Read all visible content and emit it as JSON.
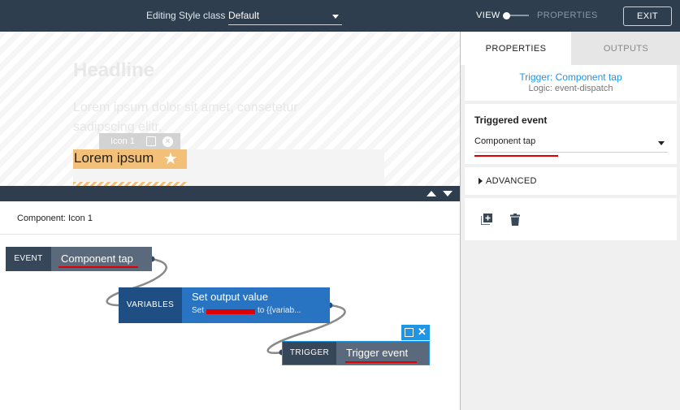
{
  "topbar": {
    "style_label": "Editing Style class",
    "style_value": "Default",
    "view_label": "VIEW",
    "properties_label": "PROPERTIES",
    "exit_label": "EXIT"
  },
  "preview": {
    "headline": "Headline",
    "lorem": "Lorem ipsum dolor sit amet, consetetur sadipscing elitr,",
    "icon_tag": "Icon 1",
    "highlight_text": "Lorem ipsum"
  },
  "editor": {
    "title": "Component: Icon 1",
    "event_node": {
      "tag": "EVENT",
      "label": "Component tap"
    },
    "variables_node": {
      "tag": "VARIABLES",
      "title": "Set output value",
      "subtitle_start": "Set",
      "subtitle_end": "to {{variab..."
    },
    "trigger_node": {
      "tag": "TRIGGER",
      "label": "Trigger event"
    }
  },
  "panel": {
    "tabs": [
      "PROPERTIES",
      "OUTPUTS"
    ],
    "trigger_title": "Trigger: Component tap",
    "logic_line": "Logic: event-dispatch",
    "triggered_event_heading": "Triggered event",
    "triggered_event_value": "Component tap",
    "advanced_label": "ADVANCED"
  },
  "icons": [
    "chevron-down-icon",
    "toggle-knob-icon",
    "copy-icon",
    "close-icon",
    "star-icon",
    "arrow-up-icon",
    "arrow-down-icon",
    "caret-right-icon",
    "add-icon",
    "trash-icon"
  ],
  "colors": {
    "topbar": "#2e3e4e",
    "accent": "#1e96e6",
    "variables_node": "#2873c2",
    "event_node": "#5a6a7c",
    "highlight": "#f2c079",
    "redaction": "#e00000"
  }
}
